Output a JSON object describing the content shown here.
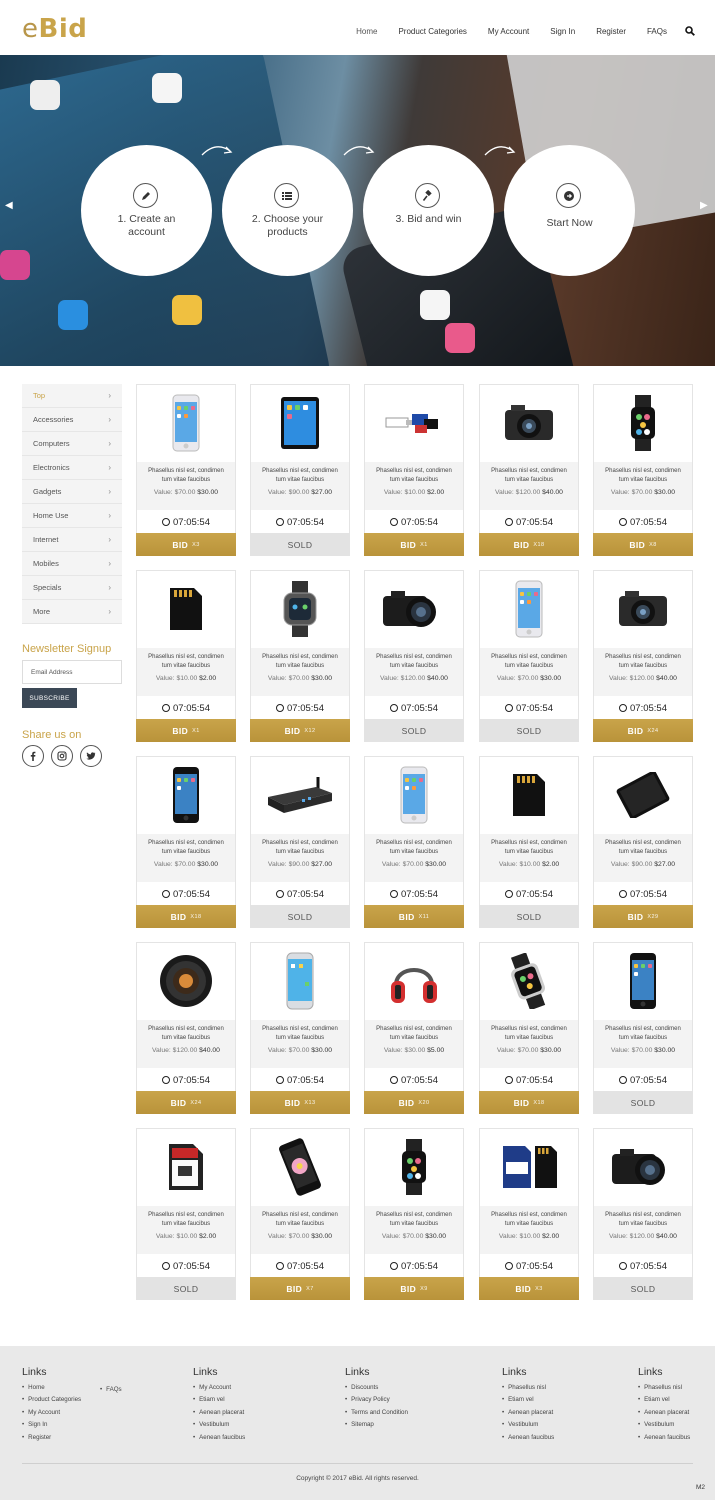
{
  "brand": {
    "prefix": "e",
    "name": "Bid"
  },
  "nav": [
    "Home",
    "Product Categories",
    "My Account",
    "Sign In",
    "Register",
    "FAQs"
  ],
  "hero_steps": [
    "1. Create an account",
    "2. Choose your products",
    "3. Bid and win",
    "Start Now"
  ],
  "categories": [
    "Top",
    "Accessories",
    "Computers",
    "Electronics",
    "Gadgets",
    "Home Use",
    "Internet",
    "Mobiles",
    "Specials",
    "More"
  ],
  "newsletter": {
    "title": "Newsletter Signup",
    "placeholder": "Email Address",
    "button": "SUBSCRIBE"
  },
  "share": {
    "title": "Share us on"
  },
  "product_text": {
    "desc_line1": "Phasellus nisl est, condimen",
    "desc_line2": "tum vitae faucibus",
    "value_label": "Value:"
  },
  "products": [
    {
      "img": "phone-white",
      "value": "$70.00",
      "price": "$30.00",
      "timer": "07:05:54",
      "action": "BID",
      "count": "X3"
    },
    {
      "img": "tablet",
      "value": "$90.00",
      "price": "$27.00",
      "timer": "07:05:54",
      "action": "SOLD",
      "count": ""
    },
    {
      "img": "usb-cards",
      "value": "$10.00",
      "price": "$2.00",
      "timer": "07:05:54",
      "action": "BID",
      "count": "X1"
    },
    {
      "img": "camera",
      "value": "$120.00",
      "price": "$40.00",
      "timer": "07:05:54",
      "action": "BID",
      "count": "X18"
    },
    {
      "img": "watch",
      "value": "$70.00",
      "price": "$30.00",
      "timer": "07:05:54",
      "action": "BID",
      "count": "X8"
    },
    {
      "img": "sd-card",
      "value": "$10.00",
      "price": "$2.00",
      "timer": "07:05:54",
      "action": "BID",
      "count": "X1"
    },
    {
      "img": "smartwatch",
      "value": "$70.00",
      "price": "$30.00",
      "timer": "07:05:54",
      "action": "BID",
      "count": "X12"
    },
    {
      "img": "dslr",
      "value": "$120.00",
      "price": "$40.00",
      "timer": "07:05:54",
      "action": "SOLD",
      "count": ""
    },
    {
      "img": "phone-white",
      "value": "$70.00",
      "price": "$30.00",
      "timer": "07:05:54",
      "action": "SOLD",
      "count": ""
    },
    {
      "img": "camera",
      "value": "$120.00",
      "price": "$40.00",
      "timer": "07:05:54",
      "action": "BID",
      "count": "X24"
    },
    {
      "img": "phone-black",
      "value": "$70.00",
      "price": "$30.00",
      "timer": "07:05:54",
      "action": "BID",
      "count": "X18"
    },
    {
      "img": "router",
      "value": "$90.00",
      "price": "$27.00",
      "timer": "07:05:54",
      "action": "SOLD",
      "count": ""
    },
    {
      "img": "phone-white",
      "value": "$70.00",
      "price": "$30.00",
      "timer": "07:05:54",
      "action": "BID",
      "count": "X11"
    },
    {
      "img": "sd-card",
      "value": "$10.00",
      "price": "$2.00",
      "timer": "07:05:54",
      "action": "SOLD",
      "count": ""
    },
    {
      "img": "tablet-black",
      "value": "$90.00",
      "price": "$27.00",
      "timer": "07:05:54",
      "action": "BID",
      "count": "X29"
    },
    {
      "img": "lens",
      "value": "$120.00",
      "price": "$40.00",
      "timer": "07:05:54",
      "action": "BID",
      "count": "X24"
    },
    {
      "img": "phone-galaxy",
      "value": "$70.00",
      "price": "$30.00",
      "timer": "07:05:54",
      "action": "BID",
      "count": "X13"
    },
    {
      "img": "headphones",
      "value": "$30.00",
      "price": "$5.00",
      "timer": "07:05:54",
      "action": "BID",
      "count": "X20"
    },
    {
      "img": "watch-leather",
      "value": "$70.00",
      "price": "$30.00",
      "timer": "07:05:54",
      "action": "BID",
      "count": "X18"
    },
    {
      "img": "phone-black",
      "value": "$70.00",
      "price": "$30.00",
      "timer": "07:05:54",
      "action": "SOLD",
      "count": ""
    },
    {
      "img": "sd-card-8gb",
      "value": "$10.00",
      "price": "$2.00",
      "timer": "07:05:54",
      "action": "SOLD",
      "count": ""
    },
    {
      "img": "phone-flower",
      "value": "$70.00",
      "price": "$30.00",
      "timer": "07:05:54",
      "action": "BID",
      "count": "X7"
    },
    {
      "img": "watch",
      "value": "$70.00",
      "price": "$30.00",
      "timer": "07:05:54",
      "action": "BID",
      "count": "X9"
    },
    {
      "img": "sd-cards",
      "value": "$10.00",
      "price": "$2.00",
      "timer": "07:05:54",
      "action": "BID",
      "count": "X3"
    },
    {
      "img": "dslr",
      "value": "$120.00",
      "price": "$40.00",
      "timer": "07:05:54",
      "action": "SOLD",
      "count": ""
    }
  ],
  "footer": {
    "cols": [
      {
        "title": "Links",
        "items": [
          "Home",
          "Product Categories",
          "My Account",
          "Sign In",
          "Register"
        ],
        "extra": [
          "FAQs"
        ]
      },
      {
        "title": "Links",
        "items": [
          "My Account",
          "Etiam vel",
          "Aenean placerat",
          "Vestibulum",
          "Aenean faucibus"
        ]
      },
      {
        "title": "Links",
        "items": [
          "Discounts",
          "Privacy Policy",
          "Terms and Condition",
          "Sitemap"
        ]
      },
      {
        "title": "Links",
        "items": [
          "Phasellus nisl",
          "Etiam vel",
          "Aenean placerat",
          "Vestibulum",
          "Aenean faucibus"
        ]
      },
      {
        "title": "Links",
        "items": [
          "Phasellus nisl",
          "Etiam vel",
          "Aenean placerat",
          "Vestibulum",
          "Aenean faucibus"
        ]
      }
    ],
    "copyright": "Copyright ©  2017  eBid. All rights reserved.",
    "badge": "M2"
  },
  "colors": {
    "gold": "#c9a44a",
    "dark": "#3b4856",
    "sold": "#e3e3e3"
  }
}
